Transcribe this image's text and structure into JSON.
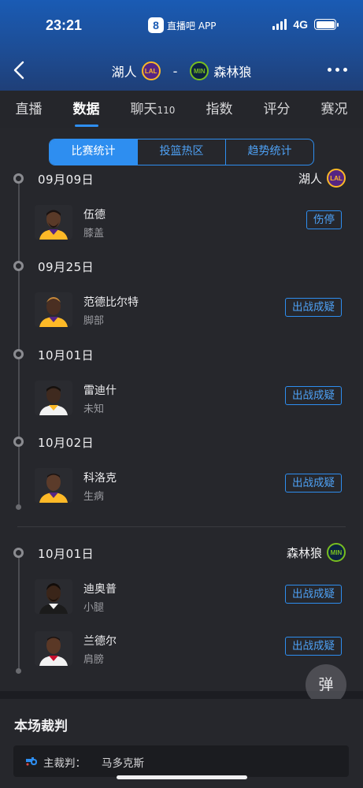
{
  "status": {
    "time": "23:21",
    "app_badge": "8",
    "app_name": "直播吧 APP",
    "network": "4G"
  },
  "nav": {
    "home_team": "湖人",
    "away_team": "森林狼",
    "home_logo": "LAL",
    "away_logo": "MIN",
    "separator": "-"
  },
  "tabs": [
    {
      "label": "直播"
    },
    {
      "label": "数据",
      "active": true
    },
    {
      "label": "聊天",
      "badge": "110"
    },
    {
      "label": "指数"
    },
    {
      "label": "评分"
    },
    {
      "label": "赛况"
    }
  ],
  "segments": [
    {
      "label": "比赛统计",
      "active": true
    },
    {
      "label": "投篮热区"
    },
    {
      "label": "趋势统计"
    }
  ],
  "lakers": {
    "team": "湖人",
    "logo": "LAL",
    "groups": [
      {
        "date": "09月09日",
        "player": {
          "name": "伍德",
          "note": "膝盖",
          "status": "伤停"
        }
      },
      {
        "date": "09月25日",
        "player": {
          "name": "范德比尔特",
          "note": "脚部",
          "status": "出战成疑"
        }
      },
      {
        "date": "10月01日",
        "player": {
          "name": "雷迪什",
          "note": "未知",
          "status": "出战成疑"
        }
      },
      {
        "date": "10月02日",
        "player": {
          "name": "科洛克",
          "note": "生病",
          "status": "出战成疑"
        }
      }
    ]
  },
  "wolves": {
    "team": "森林狼",
    "logo": "MIN",
    "date": "10月01日",
    "players": [
      {
        "name": "迪奥普",
        "note": "小腿",
        "status": "出战成疑"
      },
      {
        "name": "兰德尔",
        "note": "肩膀",
        "status": "出战成疑"
      }
    ]
  },
  "danmu_label": "弹",
  "referee": {
    "title": "本场裁判",
    "label": "主裁判：",
    "name": "马多克斯"
  },
  "colors": {
    "accent": "#2e8ef0",
    "header": "#1a5bb4",
    "background": "#1c1d22",
    "card": "#26272c"
  }
}
